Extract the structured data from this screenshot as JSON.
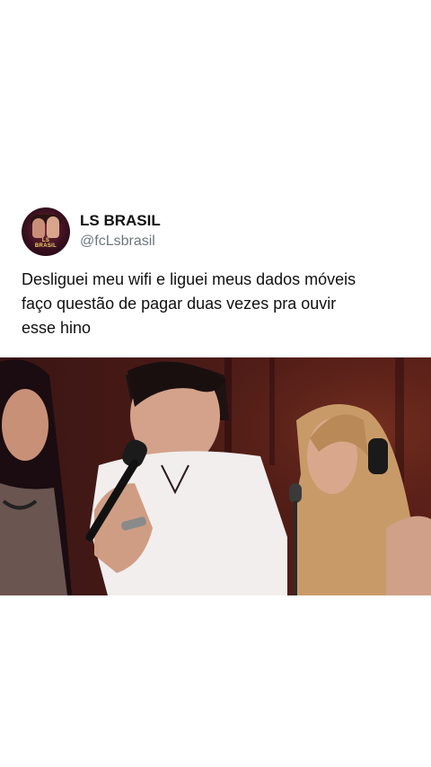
{
  "tweet": {
    "display_name": "LS BRASIL",
    "handle": "@fcLsbrasil",
    "text_lines": [
      "Desliguei meu wifi e liguei meus dados móveis",
      "faço questão de pagar duas vezes pra ouvir",
      "esse hino"
    ],
    "avatar": {
      "logo_text": "LS BRASIL"
    }
  },
  "colors": {
    "background": "#ffffff",
    "name": "#111111",
    "handle": "#6e767d",
    "media_bg": "#2b0f10"
  },
  "icons": [
    "microphone-icon"
  ]
}
